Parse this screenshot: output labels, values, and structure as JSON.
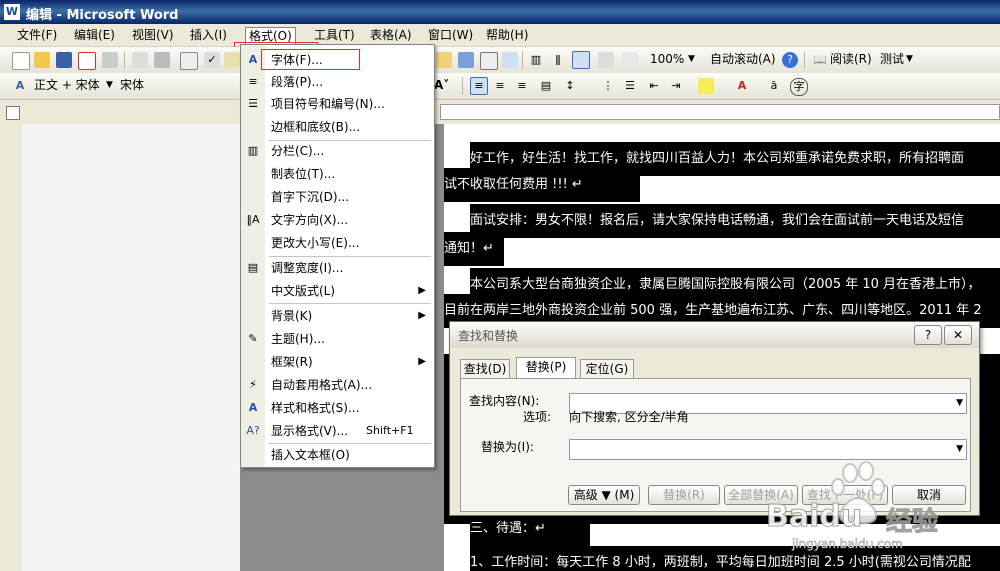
{
  "window": {
    "title": "编辑 - Microsoft Word"
  },
  "menubar": [
    {
      "label": "文件(F)"
    },
    {
      "label": "编辑(E)"
    },
    {
      "label": "视图(V)"
    },
    {
      "label": "插入(I)"
    },
    {
      "label": "格式(O)"
    },
    {
      "label": "工具(T)"
    },
    {
      "label": "表格(A)"
    },
    {
      "label": "窗口(W)"
    },
    {
      "label": "帮助(H)"
    }
  ],
  "toolbar1": {
    "zoom": "100%",
    "autoscroll": "自动滚动(A)",
    "read": "阅读(R)",
    "test": "测试"
  },
  "toolbar2": {
    "style": "正文 + 宋体",
    "font": "宋体"
  },
  "format_menu": [
    {
      "label": "字体(F)...",
      "icon": "font-A-icon"
    },
    {
      "label": "段落(P)...",
      "icon": "paragraph-icon"
    },
    {
      "label": "项目符号和编号(N)...",
      "icon": "bullets-icon"
    },
    {
      "label": "边框和底纹(B)...",
      "icon": ""
    },
    {
      "label": "分栏(C)...",
      "icon": "columns-icon"
    },
    {
      "label": "制表位(T)...",
      "icon": ""
    },
    {
      "label": "首字下沉(D)...",
      "icon": ""
    },
    {
      "label": "文字方向(X)...",
      "icon": "text-direction-icon"
    },
    {
      "label": "更改大小写(E)...",
      "icon": ""
    },
    {
      "label": "调整宽度(I)...",
      "icon": "adjust-width-icon"
    },
    {
      "label": "中文版式(L)",
      "icon": "",
      "submenu": true
    },
    {
      "label": "背景(K)",
      "icon": "",
      "submenu": true
    },
    {
      "label": "主题(H)...",
      "icon": "theme-icon"
    },
    {
      "label": "框架(R)",
      "icon": "",
      "submenu": true
    },
    {
      "label": "自动套用格式(A)...",
      "icon": "autoformat-icon"
    },
    {
      "label": "样式和格式(S)...",
      "icon": "styles-icon"
    },
    {
      "label": "显示格式(V)...",
      "icon": "reveal-format-icon",
      "shortcut": "Shift+F1"
    },
    {
      "label": "插入文本框(O)",
      "icon": ""
    }
  ],
  "document": {
    "lines": [
      "好工作，好生活！找工作，就找四川百益人力！本公司郑重承诺免费求职，所有招聘面",
      "试不收取任何费用 !!! ↵",
      "面试安排：男女不限！报名后，请大家保持电话畅通，我们会在面试前一天电话及短信",
      "通知！↵",
      "本公司系大型台商独资企业，隶属巨腾国际控股有限公司（2005 年 10 月在香港上市），",
      "目前在两岸三地外商投资企业前 500 强，生产基地遍布江苏、广东、四川等地区。2011 年 2",
      "三、待遇：↵",
      "1、工作时间：每天工作 8 小时，两班制，平均每日加班时间 2.5 小时(需视公司情况配"
    ]
  },
  "dialog": {
    "title": "查找和替换",
    "tabs": [
      "查找(D)",
      "替换(P)",
      "定位(G)"
    ],
    "find_label": "查找内容(N):",
    "options_label": "选项:",
    "options_value": "向下搜索, 区分全/半角",
    "replace_label": "替换为(I):",
    "find_value": "",
    "replace_value": "",
    "buttons": {
      "advanced": "高级 ▼ (M)",
      "replace": "替换(R)",
      "replace_all": "全部替换(A)",
      "find_next": "查找下一处(F)",
      "cancel": "取消"
    }
  },
  "watermark": {
    "brand": "Baidu",
    "brand_cn": "经验",
    "url": "jingyan.baidu.com"
  }
}
